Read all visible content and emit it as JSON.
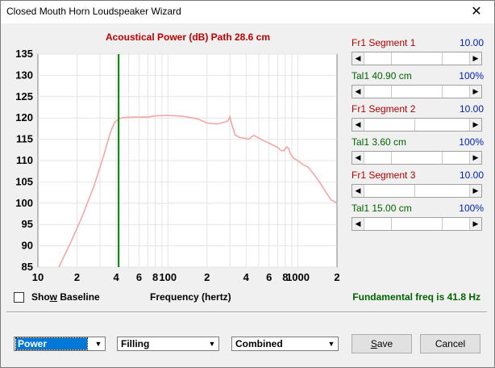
{
  "window": {
    "title": "Closed Mouth Horn Loudspeaker Wizard",
    "close_glyph": "✕"
  },
  "chart_data": {
    "type": "line",
    "title": "Acoustical Power (dB)   Path 28.6 cm",
    "xlabel": "Frequency (hertz)",
    "ylabel": "",
    "x_scale": "log",
    "xlim": [
      10,
      2000
    ],
    "ylim": [
      85,
      135
    ],
    "yticks": [
      85,
      90,
      95,
      100,
      105,
      110,
      115,
      120,
      125,
      130,
      135
    ],
    "xtick_labels": [
      {
        "value": 10,
        "label": "10"
      },
      {
        "value": 20,
        "label": "2"
      },
      {
        "value": 40,
        "label": "4"
      },
      {
        "value": 60,
        "label": "6"
      },
      {
        "value": 80,
        "label": "8"
      },
      {
        "value": 100,
        "label": "100"
      },
      {
        "value": 200,
        "label": "2"
      },
      {
        "value": 400,
        "label": "4"
      },
      {
        "value": 600,
        "label": "6"
      },
      {
        "value": 800,
        "label": "8"
      },
      {
        "value": 1000,
        "label": "1000"
      },
      {
        "value": 2000,
        "label": "2"
      }
    ],
    "grid": true,
    "marker_line": {
      "x": 41.8,
      "color": "#008000"
    },
    "series": [
      {
        "color": "#f4a6a6",
        "points": [
          [
            14.5,
            85
          ],
          [
            18,
            91
          ],
          [
            22,
            97
          ],
          [
            27,
            104
          ],
          [
            32,
            111
          ],
          [
            36,
            116.5
          ],
          [
            39,
            119
          ],
          [
            42,
            119.8
          ],
          [
            45,
            120.1
          ],
          [
            55,
            120.2
          ],
          [
            70,
            120.2
          ],
          [
            80,
            120.5
          ],
          [
            100,
            120.6
          ],
          [
            130,
            120.4
          ],
          [
            170,
            119.8
          ],
          [
            200,
            118.8
          ],
          [
            240,
            118.6
          ],
          [
            270,
            119
          ],
          [
            290,
            119.3
          ],
          [
            300,
            120.3
          ],
          [
            310,
            118.5
          ],
          [
            330,
            116
          ],
          [
            360,
            115.4
          ],
          [
            400,
            115.2
          ],
          [
            420,
            115
          ],
          [
            440,
            115.6
          ],
          [
            460,
            115.9
          ],
          [
            500,
            115.3
          ],
          [
            550,
            114.6
          ],
          [
            600,
            114.1
          ],
          [
            650,
            113.6
          ],
          [
            700,
            113.1
          ],
          [
            740,
            112.4
          ],
          [
            780,
            112.3
          ],
          [
            820,
            113.2
          ],
          [
            850,
            112.8
          ],
          [
            880,
            111.5
          ],
          [
            930,
            110.5
          ],
          [
            1000,
            110
          ],
          [
            1100,
            109
          ],
          [
            1200,
            108.5
          ],
          [
            1350,
            106.5
          ],
          [
            1500,
            104.5
          ],
          [
            1650,
            102.5
          ],
          [
            1800,
            100.8
          ],
          [
            2000,
            100
          ]
        ]
      }
    ]
  },
  "segments": [
    {
      "label": "Fr1  Segment 1",
      "value": "10.00",
      "position": 0.5
    },
    {
      "label": "Tal1  40.90 cm",
      "value": "100%",
      "position": 0.5
    },
    {
      "label": "Fr1  Segment 2",
      "value": "10.00",
      "position": 0.0
    },
    {
      "label": "Tal1  3.60 cm",
      "value": "100%",
      "position": 0.5
    },
    {
      "label": "Fr1  Segment 3",
      "value": "10.00",
      "position": 0.0
    },
    {
      "label": "Tal1  15.00 cm",
      "value": "100%",
      "position": 0.5
    }
  ],
  "colors": {
    "fr_label": "#b00000",
    "tal_label": "#006400",
    "value": "#0020c0"
  },
  "show_baseline": {
    "label_pre": "Sho",
    "label_key": "w",
    "label_post": " Baseline",
    "checked": false
  },
  "fundamental": "Fundamental freq is 41.8 Hz",
  "selects": {
    "mode": "Power",
    "filling": "Filling",
    "combine": "Combined"
  },
  "buttons": {
    "save_key": "S",
    "save_rest": "ave",
    "cancel": "Cancel"
  }
}
